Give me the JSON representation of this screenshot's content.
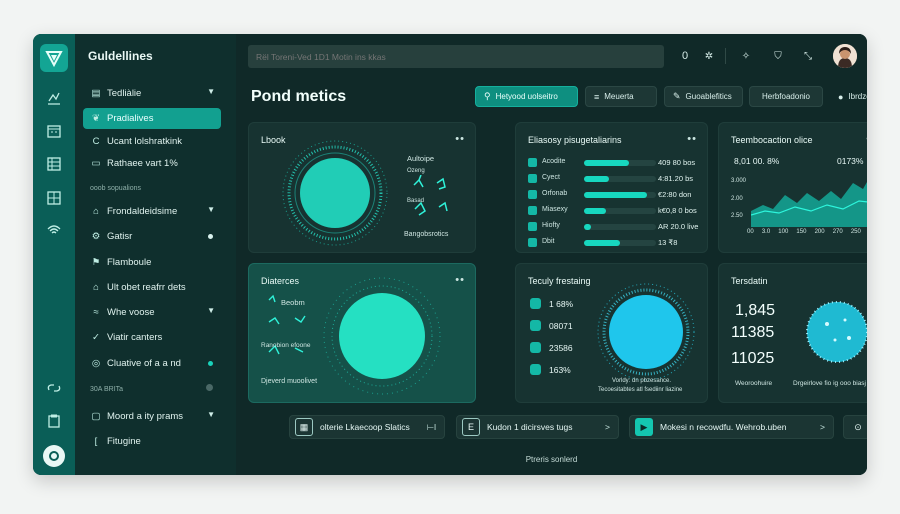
{
  "app": {
    "title": "Guldellines"
  },
  "search": {
    "placeholder": "Rël Toreni-Ved 1D1 Motin ins kkas"
  },
  "topbar": {
    "zero": "0",
    "icons": [
      "settings-icon",
      "star-icon",
      "shield-icon",
      "expand-icon"
    ]
  },
  "rail": {
    "icons": [
      "logo-icon",
      "chart-icon",
      "calendar-icon",
      "table-icon",
      "grid-icon",
      "wifi-icon",
      "link-icon",
      "clipboard-icon",
      "circle-icon"
    ]
  },
  "sidebar": {
    "items": [
      {
        "label": "Tedliàlie",
        "icon": "list-icon",
        "chevron": true
      },
      {
        "label": "Pradialives",
        "icon": "leaf-icon",
        "active": true
      },
      {
        "label": "Ucant lolshratkink",
        "icon": "c-icon"
      },
      {
        "label": "Rathaee vart 1%",
        "icon": "tag-icon"
      },
      {
        "label": "Frondaldeidsime",
        "icon": "tag-icon",
        "chevron": true
      },
      {
        "label": "Gatisr",
        "icon": "gear-icon",
        "dot": true
      },
      {
        "label": "Flamboule",
        "icon": "flag-icon"
      },
      {
        "label": "Ult obet reafrr dets",
        "icon": "house-icon"
      },
      {
        "label": "Whe voose",
        "icon": "water-icon",
        "chevron": true
      },
      {
        "label": "Viatir canters",
        "icon": "check-icon"
      },
      {
        "label": "Cluative of a a nd",
        "icon": "circle-icon",
        "dot_teal": true
      },
      {
        "label": "Moord a ity prams",
        "icon": "paper-icon",
        "chevron": true
      },
      {
        "label": "Fitugine",
        "icon": "bracket-icon"
      }
    ],
    "sections": [
      "ooob sopualions",
      "30A BRITa"
    ]
  },
  "main": {
    "title": "Pond metics",
    "pills": [
      {
        "label": "Hetyood uolseitro",
        "icon": "search-icon"
      },
      {
        "label": "Meuerta",
        "icon": "menu-icon"
      },
      {
        "label": "Guoablefitics",
        "icon": "pen-icon"
      },
      {
        "label": "Herbfoadonio",
        "icon": ""
      },
      {
        "label": "Ibrdzo",
        "icon": "apple-icon"
      }
    ]
  },
  "cards": {
    "lbook": {
      "title": "Lbook",
      "labels": [
        "Aultoipe",
        "Ozeng",
        "Basad",
        "Bangobsrotics"
      ]
    },
    "elasosy": {
      "title": "Eliasosy pisugetaliarins",
      "rows": [
        {
          "label": "Acodite",
          "value": "409 80 bos",
          "fill": 0.62
        },
        {
          "label": "Cyect",
          "value": "4:81.20 bs",
          "fill": 0.35
        },
        {
          "label": "Orfonab",
          "value": "€2:80 don",
          "fill": 0.88
        },
        {
          "label": "Miasexy",
          "value": "k€0,8 0 bos",
          "fill": 0.3
        },
        {
          "label": "Hiofty",
          "value": "AR 20.0 live",
          "fill": 0.1
        },
        {
          "label": "Dbit",
          "value": "13 ₹8",
          "fill": 0.5
        }
      ]
    },
    "teembo": {
      "title": "Teembocaction olice",
      "stat_left": "8,01 00. 8%",
      "stat_right": "0173%",
      "yticks": [
        "3.000",
        "2.00",
        "2.50"
      ],
      "xticks": [
        "00",
        "3.0",
        "100",
        "150",
        "200",
        "270",
        "250",
        "250"
      ]
    },
    "diateres": {
      "title": "Diaterces",
      "labels": [
        "Beobm",
        "Ranobion efoone",
        "Djeverd muoolivet"
      ]
    },
    "teculy": {
      "title": "Teculy frestaing",
      "items": [
        {
          "label": "1 68%",
          "icon": "plus-icon"
        },
        {
          "label": "08071",
          "icon": "pie-icon"
        },
        {
          "label": "23586",
          "icon": "plus-icon"
        },
        {
          "label": "163%",
          "icon": "plus-icon"
        }
      ],
      "captions": [
        "Vorldy: dn pbzesance.",
        "Tecoesitabtes atl fsediinr liazine"
      ]
    },
    "tensdatin": {
      "title": "Tersdatin",
      "values": [
        "1,845",
        "11385",
        "11025"
      ],
      "captions": [
        "Weoroohuire",
        "Drgeirlove fio ig ooo biasj"
      ]
    }
  },
  "bottom": [
    {
      "label": "olterie Lkaecoop Slatics",
      "icon": "grid-icon",
      "suffix": "⊢l"
    },
    {
      "label": "Kudon 1 dicirsves tugs",
      "icon": "e-icon",
      "suffix": ">"
    },
    {
      "label": "Mokesi n recowdfu. Wehrob.uben",
      "icon": "play-icon",
      "suffix": ">"
    },
    {
      "label": "",
      "icon": "circle-dot-icon",
      "suffix": "→"
    }
  ],
  "footer": "Ptreris sonlerd"
}
